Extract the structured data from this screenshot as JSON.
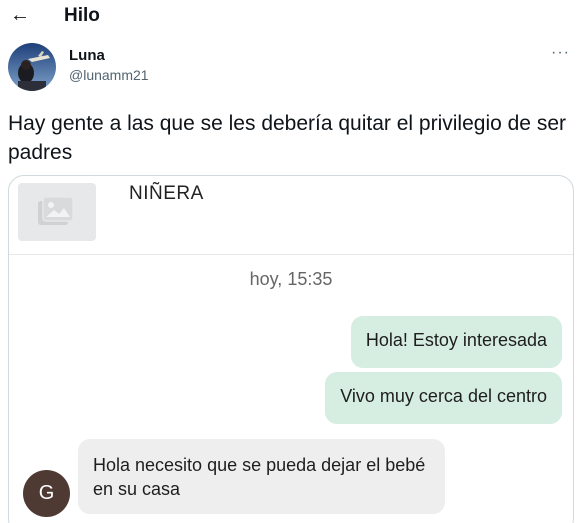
{
  "header": {
    "back_icon": "arrow-left-icon",
    "title": "Hilo"
  },
  "tweet": {
    "author_name": "Luna",
    "author_handle": "@lunamm21",
    "more_icon": "more-horizontal-icon",
    "text": "Hay gente a las que se les debería quitar el privilegio de ser padres"
  },
  "media": {
    "listing_title": "NIÑERA",
    "thumbnail_icon": "image-placeholder-icon",
    "timestamp": "hoy, 15:35",
    "messages": [
      {
        "side": "out",
        "text": "Hola! Estoy interesada"
      },
      {
        "side": "out",
        "text": "Vivo muy cerca del centro"
      },
      {
        "side": "in",
        "text": "Hola necesito que se pueda dejar el bebé en su casa"
      }
    ],
    "sender_initial": "G"
  },
  "colors": {
    "outgoing_bubble": "#d6ede2",
    "incoming_bubble": "#eeeeee",
    "sender_avatar": "#4e3a33",
    "handle_gray": "#536471"
  }
}
